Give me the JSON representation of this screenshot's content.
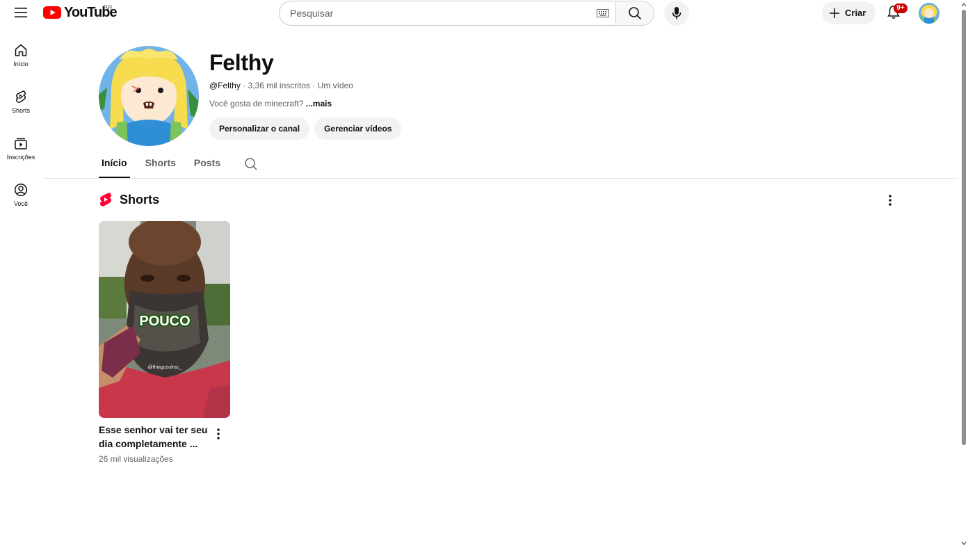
{
  "topbar": {
    "logo_text": "YouTube",
    "country_code": "BR",
    "search_placeholder": "Pesquisar",
    "create_label": "Criar",
    "notification_count": "9+"
  },
  "nav": [
    {
      "label": "Início",
      "icon": "home-icon"
    },
    {
      "label": "Shorts",
      "icon": "shorts-icon"
    },
    {
      "label": "Inscrições",
      "icon": "subscriptions-icon"
    },
    {
      "label": "Você",
      "icon": "you-icon"
    }
  ],
  "channel": {
    "name": "Felthy",
    "handle": "@Felthy",
    "subscribers": "3,36 mil inscritos",
    "videos": "Um vídeo",
    "separator": "·",
    "description": "Você gosta de minecraft?",
    "more_label": "...mais",
    "customize_button": "Personalizar o canal",
    "manage_button": "Gerenciar vídeos"
  },
  "tabs": [
    {
      "label": "Início",
      "active": true
    },
    {
      "label": "Shorts",
      "active": false
    },
    {
      "label": "Posts",
      "active": false
    }
  ],
  "shorts_section": {
    "title": "Shorts",
    "items": [
      {
        "title_line1": "Esse senhor vai ter seu",
        "title_line2": "dia completamente ...",
        "views": "26 mil visualizações",
        "thumb_caption": "POUCO",
        "thumb_watermark": "@thiagosolrac_"
      }
    ]
  },
  "colors": {
    "brand_red": "#ff0000",
    "badge_red": "#cc0000",
    "text_primary": "#0f0f0f",
    "text_secondary": "#606060",
    "button_bg": "#f2f2f2"
  }
}
